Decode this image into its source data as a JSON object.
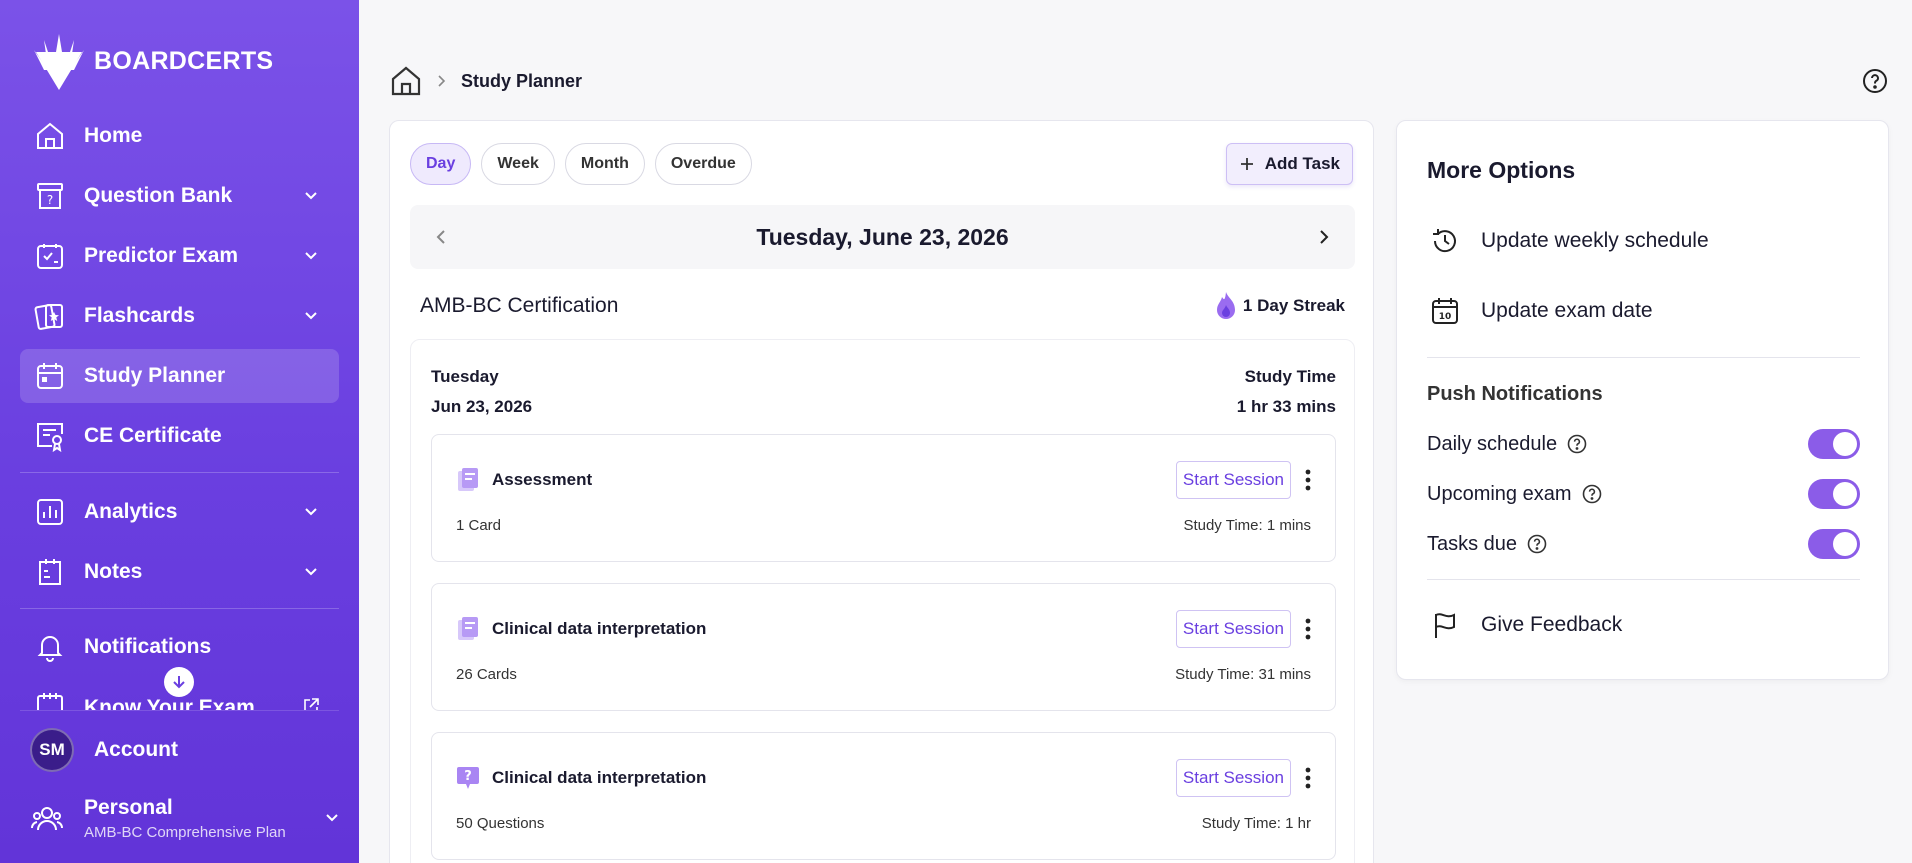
{
  "brand": {
    "name": "BOARDCERTS"
  },
  "sidebar": {
    "items": [
      {
        "label": "Home",
        "icon": "home-icon"
      },
      {
        "label": "Question Bank",
        "icon": "question-bank-icon"
      },
      {
        "label": "Predictor Exam",
        "icon": "predictor-exam-icon"
      },
      {
        "label": "Flashcards",
        "icon": "flashcards-icon"
      },
      {
        "label": "Study Planner",
        "icon": "calendar-icon"
      },
      {
        "label": "CE Certificate",
        "icon": "certificate-icon"
      },
      {
        "label": "Analytics",
        "icon": "analytics-icon"
      },
      {
        "label": "Notes",
        "icon": "notes-icon"
      },
      {
        "label": "Notifications",
        "icon": "bell-icon"
      },
      {
        "label": "Know Your Exam",
        "icon": "exam-calendar-icon"
      }
    ],
    "account": {
      "initials": "SM",
      "label": "Account"
    },
    "plan": {
      "name": "Personal",
      "sub": "AMB-BC Comprehensive Plan"
    }
  },
  "breadcrumb": {
    "current": "Study Planner"
  },
  "planner": {
    "tabs": [
      "Day",
      "Week",
      "Month",
      "Overdue"
    ],
    "active_tab": "Day",
    "add_task_label": "Add Task",
    "date": "Tuesday, June 23, 2026",
    "certification": "AMB-BC Certification",
    "streak": "1 Day Streak",
    "day_name": "Tuesday",
    "day_date": "Jun 23, 2026",
    "study_time_label": "Study Time",
    "study_time_value": "1 hr 33 mins",
    "tasks": [
      {
        "name": "Assessment",
        "count": "1 Card",
        "time": "Study Time: 1 mins",
        "button": "Start Session",
        "icon": "flashcard-icon"
      },
      {
        "name": "Clinical data interpretation",
        "count": "26 Cards",
        "time": "Study Time: 31 mins",
        "button": "Start Session",
        "icon": "flashcard-icon"
      },
      {
        "name": "Clinical data interpretation",
        "count": "50 Questions",
        "time": "Study Time: 1 hr",
        "button": "Start Session",
        "icon": "question-icon"
      }
    ]
  },
  "more_options": {
    "title": "More Options",
    "update_schedule": "Update weekly schedule",
    "update_exam": "Update exam date",
    "push_title": "Push Notifications",
    "toggles": [
      {
        "label": "Daily schedule",
        "on": true
      },
      {
        "label": "Upcoming exam",
        "on": true
      },
      {
        "label": "Tasks due",
        "on": true
      }
    ],
    "feedback": "Give Feedback"
  },
  "colors": {
    "accent": "#6a3fe0",
    "sidebar": "#7b52e8",
    "toggle": "#8b5ce8"
  }
}
